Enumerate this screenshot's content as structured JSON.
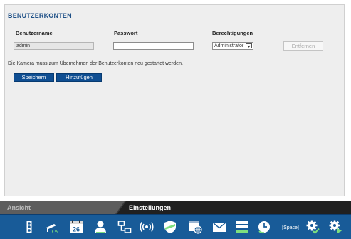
{
  "title": "BENUTZERKONTEN",
  "columns": {
    "username": "Benutzername",
    "password": "Passwort",
    "permissions": "Berechtigungen"
  },
  "row": {
    "username_value": "admin",
    "password_value": "",
    "permission_value": "Administrator",
    "remove_label": "Entfernen"
  },
  "notice": "Die Kamera muss zum Übernehmen der Benutzerkonten neu gestartet werden.",
  "buttons": {
    "save": "Speichern",
    "add": "Hinzufügen"
  },
  "tabs": {
    "view": "Ansicht",
    "settings": "Einstellungen"
  },
  "icons": {
    "calendar_day": "26",
    "space_label": "[Space]",
    "items": [
      "traffic-light-icon",
      "camera-icon",
      "calendar-icon",
      "user-icon",
      "network-icon",
      "wireless-icon",
      "shield-icon",
      "browser-globe-icon",
      "mail-icon",
      "storage-icon",
      "clock-icon",
      "space-icon",
      "gear-check-icon",
      "gear-play-icon"
    ]
  },
  "colors": {
    "accent": "#1d4f86",
    "button": "#0f4e92",
    "iconbar": "#185b98",
    "tab_active": "#202020",
    "tab_inactive": "#5d5d5d"
  }
}
